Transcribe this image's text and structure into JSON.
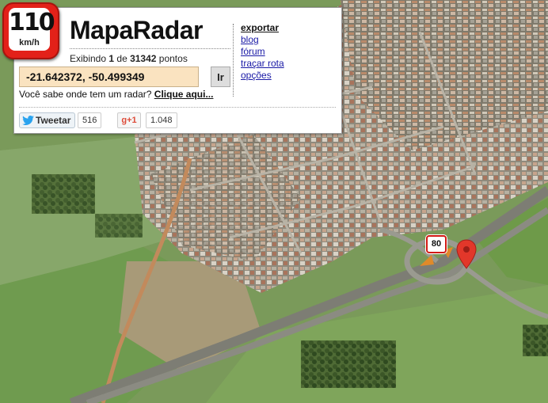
{
  "app": {
    "logo_speed": "110",
    "logo_unit": "km/h",
    "title": "MapaRadar"
  },
  "status": {
    "prefix": "Exibindo ",
    "shown": "1",
    "middle": " de ",
    "total": "31342",
    "suffix": " pontos"
  },
  "search": {
    "value": "-21.642372, -50.499349",
    "go_label": "Ir"
  },
  "prompt": {
    "question": "Você sabe onde tem um radar? ",
    "link": "Clique aqui..."
  },
  "menu": {
    "items": [
      {
        "label": "exportar"
      },
      {
        "label": "blog"
      },
      {
        "label": "fórum"
      },
      {
        "label": "traçar rota"
      },
      {
        "label": "opções"
      }
    ]
  },
  "social": {
    "tweet_label": "Tweetar",
    "tweet_count": "516",
    "gplus_label": "+1",
    "gplus_count": "1.048"
  },
  "map": {
    "speed_sign": "80",
    "pin_color": "#e2372a",
    "sign_border_color": "#d21a14"
  }
}
